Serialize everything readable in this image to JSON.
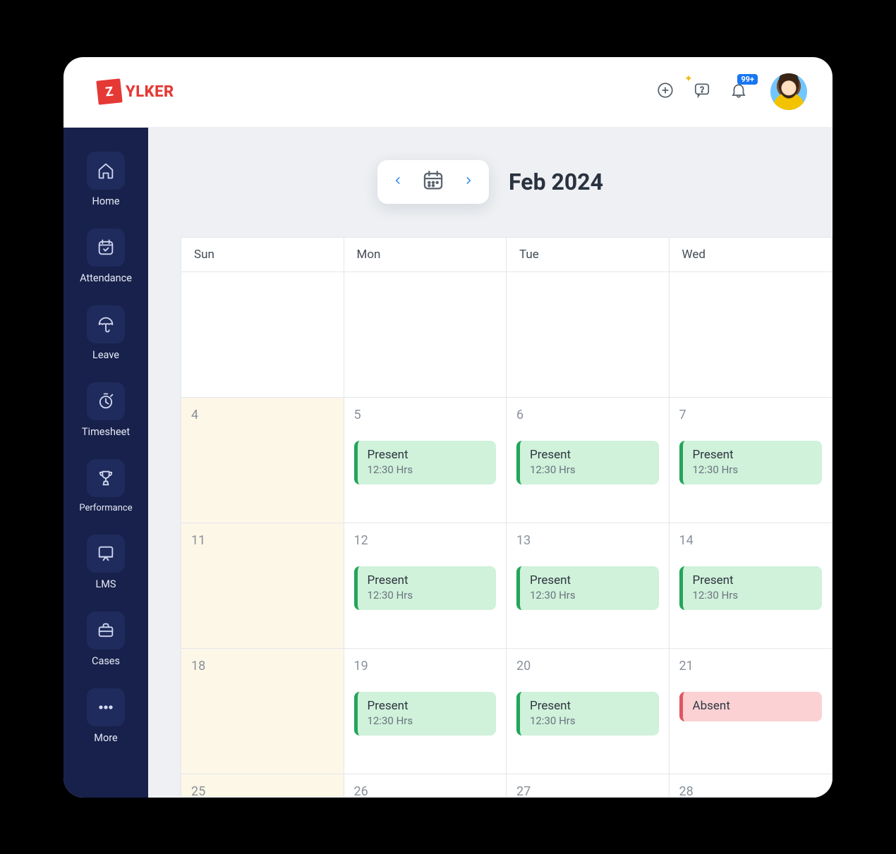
{
  "brand": {
    "tile": "Z",
    "name": "YLKER"
  },
  "topbar": {
    "notification_badge": "99+"
  },
  "sidebar": {
    "items": [
      {
        "id": "home",
        "label": "Home"
      },
      {
        "id": "attendance",
        "label": "Attendance"
      },
      {
        "id": "leave",
        "label": "Leave"
      },
      {
        "id": "timesheet",
        "label": "Timesheet"
      },
      {
        "id": "performance",
        "label": "Performance"
      },
      {
        "id": "lms",
        "label": "LMS"
      },
      {
        "id": "cases",
        "label": "Cases"
      },
      {
        "id": "more",
        "label": "More"
      }
    ]
  },
  "calendar": {
    "month_label": "Feb 2024",
    "day_headers": [
      "Sun",
      "Mon",
      "Tue",
      "Wed"
    ],
    "rows": [
      [
        {
          "day": "",
          "weekend": false
        },
        {
          "day": "",
          "weekend": false
        },
        {
          "day": "",
          "weekend": false
        },
        {
          "day": "",
          "weekend": false
        }
      ],
      [
        {
          "day": "4",
          "weekend": true
        },
        {
          "day": "5",
          "status": "present",
          "title": "Present",
          "sub": "12:30 Hrs"
        },
        {
          "day": "6",
          "status": "present",
          "title": "Present",
          "sub": "12:30 Hrs"
        },
        {
          "day": "7",
          "status": "present",
          "title": "Present",
          "sub": "12:30 Hrs"
        }
      ],
      [
        {
          "day": "11",
          "weekend": true
        },
        {
          "day": "12",
          "status": "present",
          "title": "Present",
          "sub": "12:30 Hrs"
        },
        {
          "day": "13",
          "status": "present",
          "title": "Present",
          "sub": "12:30 Hrs"
        },
        {
          "day": "14",
          "status": "present",
          "title": "Present",
          "sub": "12:30 Hrs"
        }
      ],
      [
        {
          "day": "18",
          "weekend": true
        },
        {
          "day": "19",
          "status": "present",
          "title": "Present",
          "sub": "12:30 Hrs"
        },
        {
          "day": "20",
          "status": "present",
          "title": "Present",
          "sub": "12:30 Hrs"
        },
        {
          "day": "21",
          "status": "absent",
          "title": "Absent"
        }
      ],
      [
        {
          "day": "25",
          "weekend": true
        },
        {
          "day": "26"
        },
        {
          "day": "27"
        },
        {
          "day": "28"
        }
      ]
    ]
  }
}
